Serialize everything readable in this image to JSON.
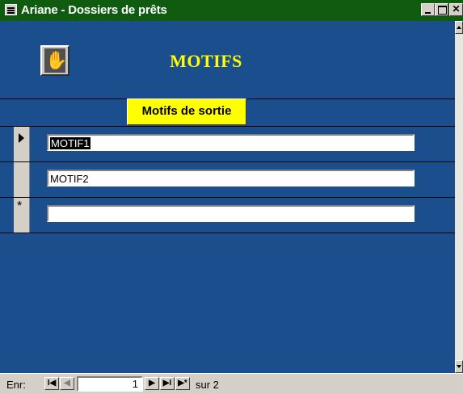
{
  "window": {
    "title": "Ariane - Dossiers de prêts",
    "title_bar_color": "#0f5b10"
  },
  "form": {
    "background_color": "#1a4e8c",
    "header_title": "MOTIFS",
    "header_title_color": "#ffff00",
    "section_label": "Motifs de sortie",
    "section_label_color": "#ffff00",
    "icon": "hand-icon"
  },
  "rows": [
    {
      "value": "MOTIF1",
      "selector": "current-record-arrow",
      "selected": true
    },
    {
      "value": "MOTIF2",
      "selector": "none",
      "selected": false
    },
    {
      "value": "",
      "selector": "new-record-star",
      "selected": false
    }
  ],
  "navigation": {
    "label": "Enr:",
    "current_record": "1",
    "total_text": "sur  2",
    "first_symbol": "I◀",
    "prev_symbol": "◀",
    "next_symbol": "▶",
    "last_symbol": "▶I",
    "new_symbol": "▶*"
  },
  "title_buttons": {
    "close_symbol": "✕"
  },
  "new_row_symbol": "*"
}
